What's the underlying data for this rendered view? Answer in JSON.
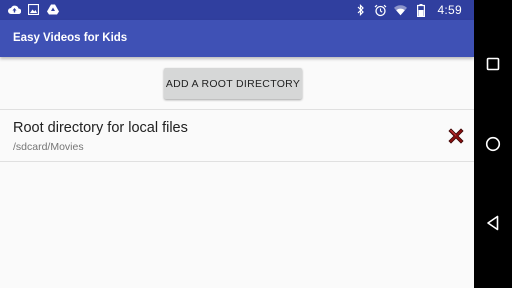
{
  "status_bar": {
    "time": "4:59",
    "left_icons": [
      "cloud-upload-icon",
      "image-icon",
      "drive-icon"
    ],
    "right_icons": [
      "bluetooth-icon",
      "alarm-icon",
      "wifi-icon",
      "battery-icon"
    ]
  },
  "app_bar": {
    "title": "Easy Videos for Kids",
    "color": "#3f51b5",
    "status_color": "#303f9f"
  },
  "main": {
    "add_button_label": "ADD A ROOT DIRECTORY",
    "directories": [
      {
        "name": "Root directory for local files",
        "path": "/sdcard/Movies",
        "action_icon": "remove-x-icon"
      }
    ]
  },
  "nav_bar": {
    "buttons": [
      "recents-square-icon",
      "home-circle-icon",
      "back-triangle-icon"
    ]
  },
  "colors": {
    "remove_icon": "#8b1010",
    "button_bg": "#d6d7d7"
  }
}
